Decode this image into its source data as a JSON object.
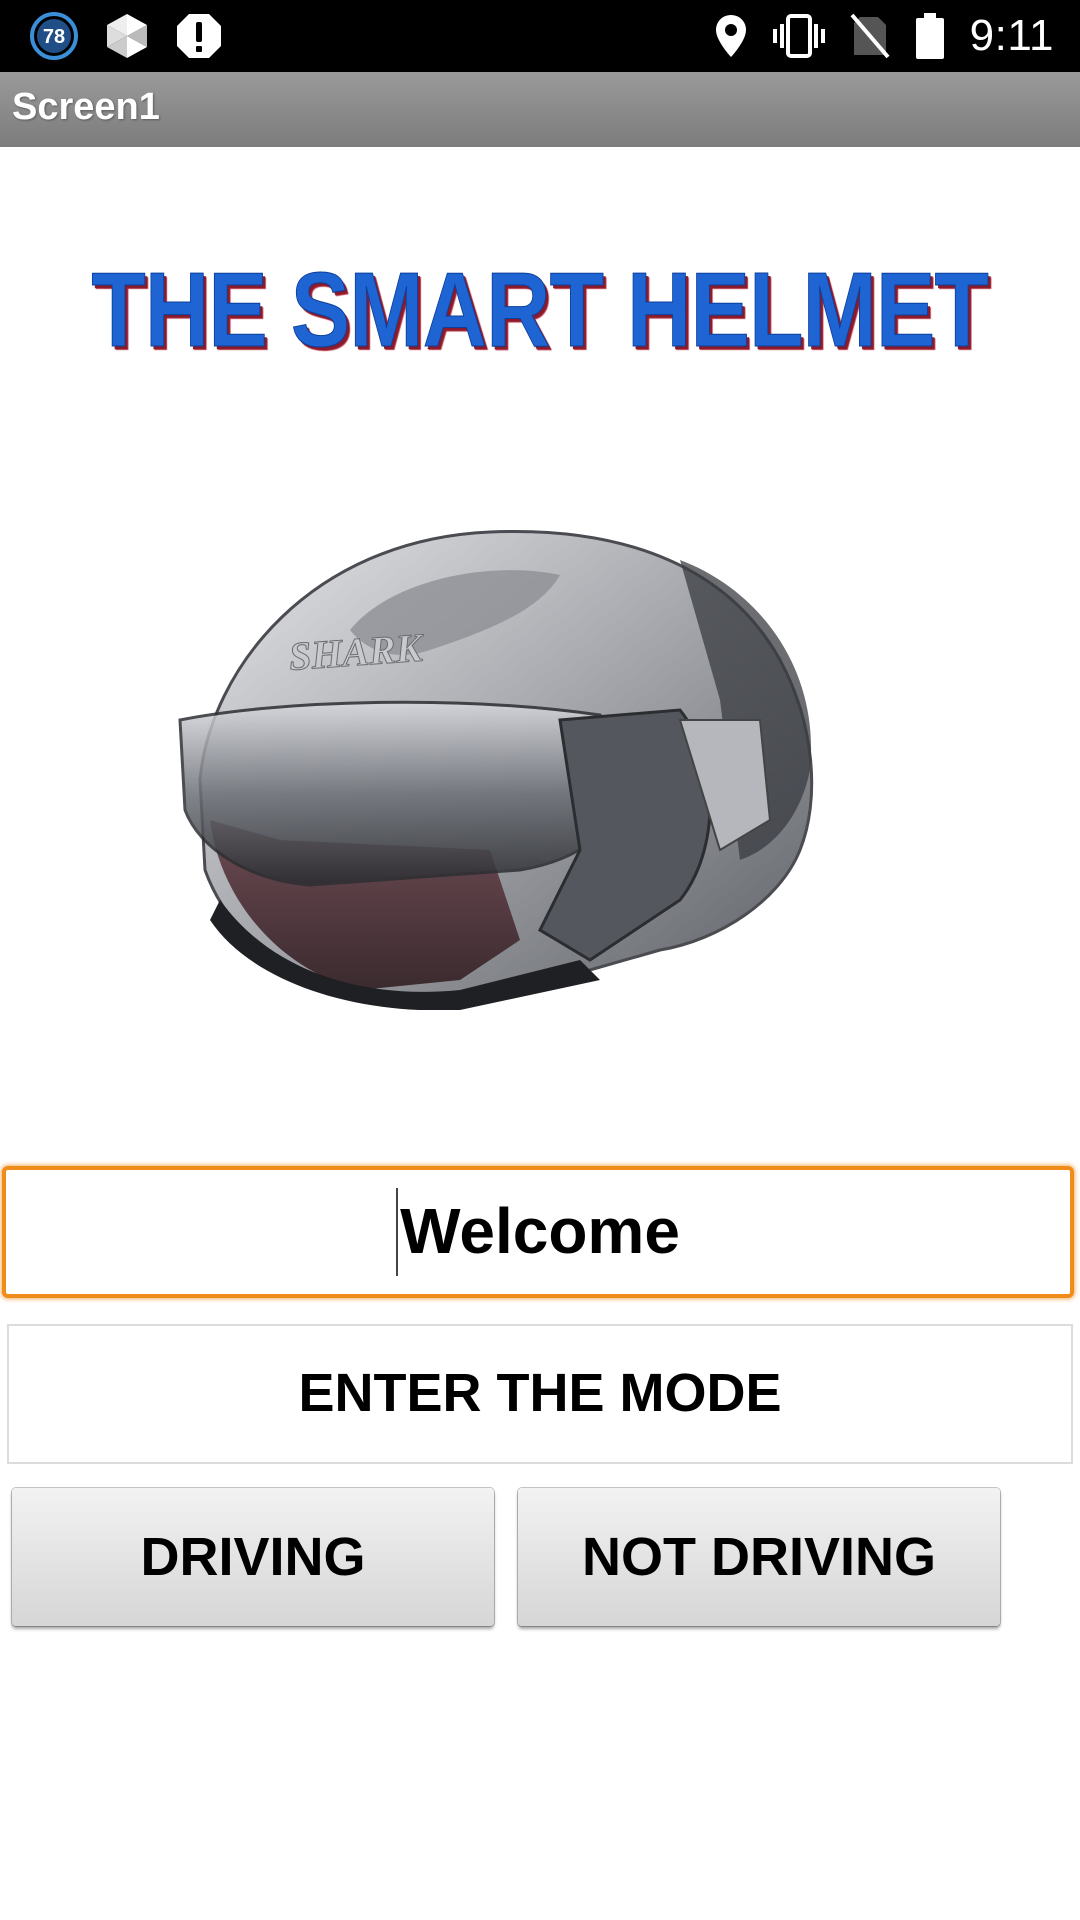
{
  "status_bar": {
    "notification_badge": "78",
    "time": "9:11",
    "icons": [
      "sync-badge-icon",
      "app-icon",
      "alert-icon",
      "location-icon",
      "vibrate-icon",
      "no-sim-icon",
      "battery-icon"
    ]
  },
  "app": {
    "title": "Screen1"
  },
  "logo": {
    "text": "THE SMART HELMET"
  },
  "helmet_image": {
    "brand_text": "SHARK"
  },
  "welcome_field": {
    "value": "Welcome"
  },
  "mode_label": {
    "text": "ENTER THE MODE"
  },
  "buttons": {
    "driving": "DRIVING",
    "not_driving": "NOT DRIVING"
  },
  "colors": {
    "focus_border": "#f08c1a",
    "logo_blue": "#1e64d2",
    "logo_shadow": "#8b1a2a",
    "title_bar": "#8a8a8a"
  }
}
